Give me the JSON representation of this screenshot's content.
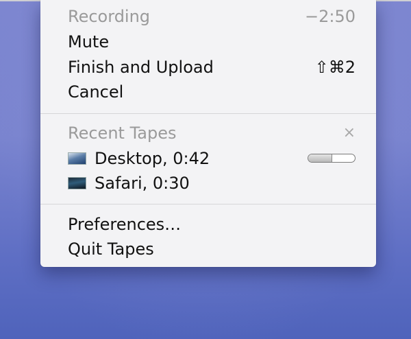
{
  "recording": {
    "header": "Recording",
    "time_remaining": "−2:50",
    "mute": "Mute",
    "finish_upload": "Finish and Upload",
    "finish_shortcut": "⇧⌘2",
    "cancel": "Cancel"
  },
  "recent": {
    "header": "Recent Tapes",
    "close_glyph": "×",
    "tapes": [
      {
        "label": "Desktop, 0:42",
        "thumbnail_icon": "desktop-thumbnail",
        "upload_progress": 0.5
      },
      {
        "label": "Safari, 0:30",
        "thumbnail_icon": "safari-thumbnail"
      }
    ]
  },
  "app": {
    "preferences": "Preferences…",
    "quit": "Quit Tapes"
  }
}
